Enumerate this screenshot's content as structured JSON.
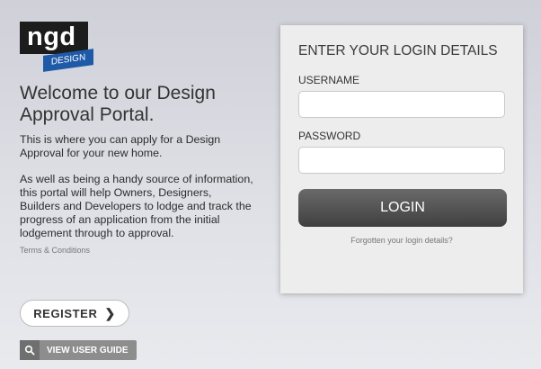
{
  "logo": {
    "main_text": "ngd",
    "sub_text": "DESIGN"
  },
  "welcome": {
    "heading": "Welcome to our Design Approval Portal.",
    "para1": "This is where you can apply for a Design Approval for your new home.",
    "para2": "As well as being a handy source of information, this portal will help Owners, Designers, Builders and Developers to lodge and track the progress of an application from the initial lodgement through to approval.",
    "terms_link": "Terms & Conditions"
  },
  "actions": {
    "register_label": "REGISTER",
    "guide_label": "VIEW USER GUIDE"
  },
  "login": {
    "title": "ENTER YOUR LOGIN DETAILS",
    "username_label": "USERNAME",
    "username_value": "",
    "password_label": "PASSWORD",
    "password_value": "",
    "login_button": "LOGIN",
    "forgot_link": "Forgotten your login details?"
  }
}
